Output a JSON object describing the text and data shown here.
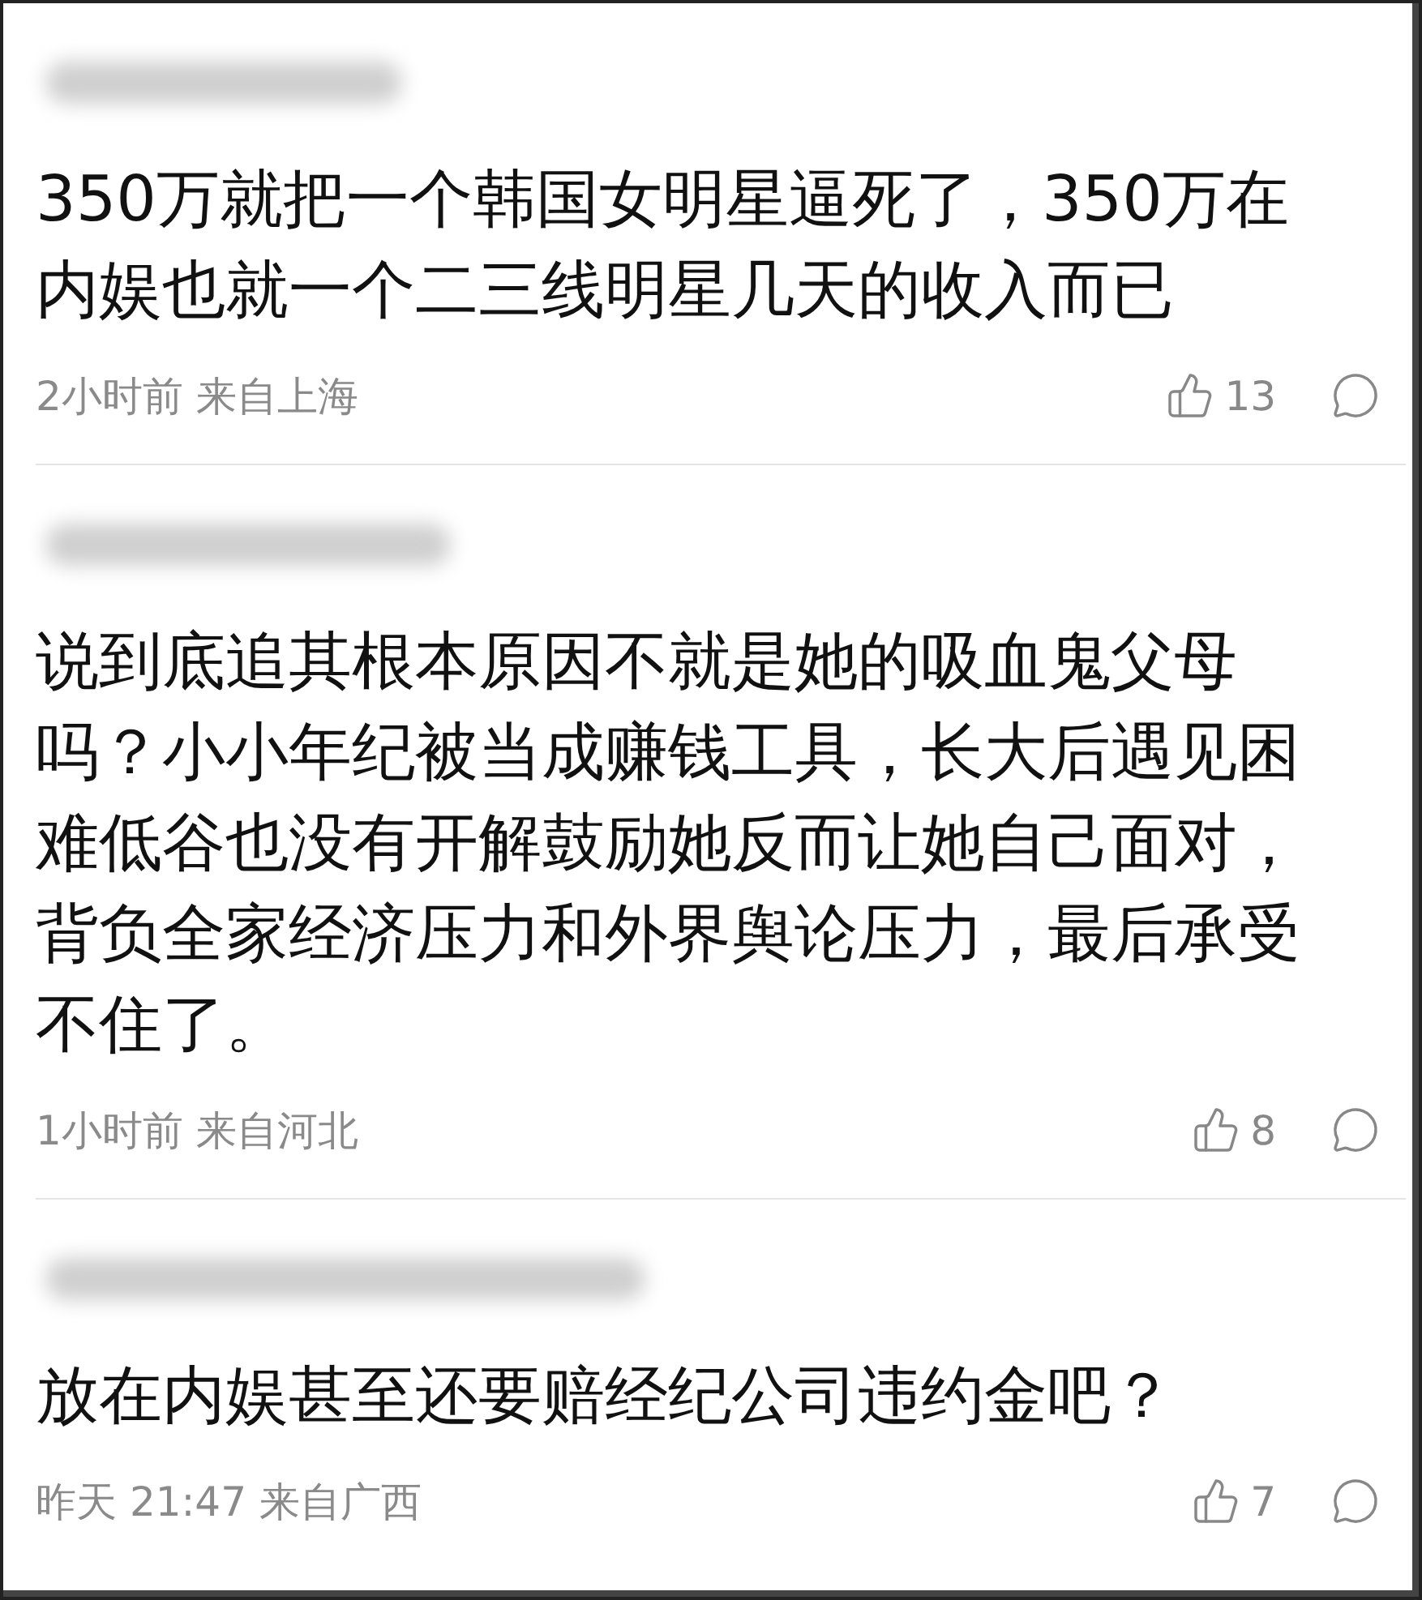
{
  "comments": [
    {
      "text": "350万就把一个韩国女明星逼死了，350万在内娱也就一个二三线明星几天的收入而已",
      "time": "2小时前",
      "location": "来自上海",
      "likes": "13"
    },
    {
      "text": "说到底追其根本原因不就是她的吸血鬼父母吗？小小年纪被当成赚钱工具，长大后遇见困难低谷也没有开解鼓励她反而让她自己面对，背负全家经济压力和外界舆论压力，最后承受不住了。",
      "time": "1小时前",
      "location": "来自河北",
      "likes": "8"
    },
    {
      "text": "放在内娱甚至还要赔经纪公司违约金吧？",
      "time": "昨天 21:47",
      "location": "来自广西",
      "likes": "7"
    }
  ]
}
